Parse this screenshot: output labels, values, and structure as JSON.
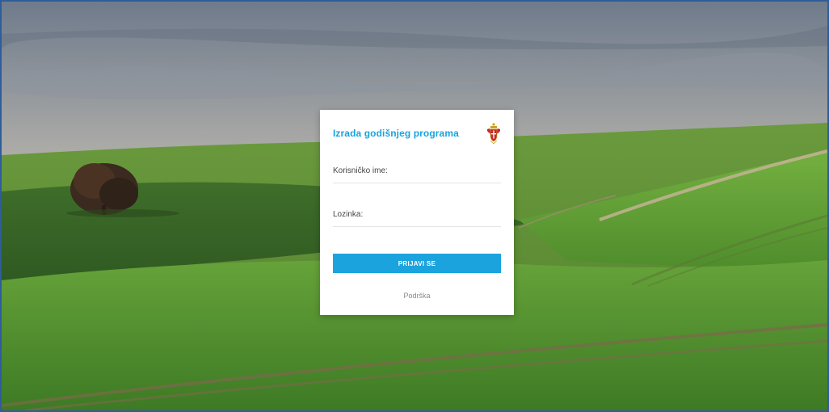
{
  "login": {
    "title": "Izrada godišnjeg programa",
    "username_label": "Korisničko ime:",
    "username_value": "",
    "password_label": "Lozinka:",
    "password_value": "",
    "submit_label": "PRIJAVI SE",
    "support_link": "Podrška"
  },
  "icons": {
    "logo": "coat-of-arms-icon"
  },
  "colors": {
    "accent": "#1aa3dd",
    "frame_border": "#2f5d9a"
  }
}
